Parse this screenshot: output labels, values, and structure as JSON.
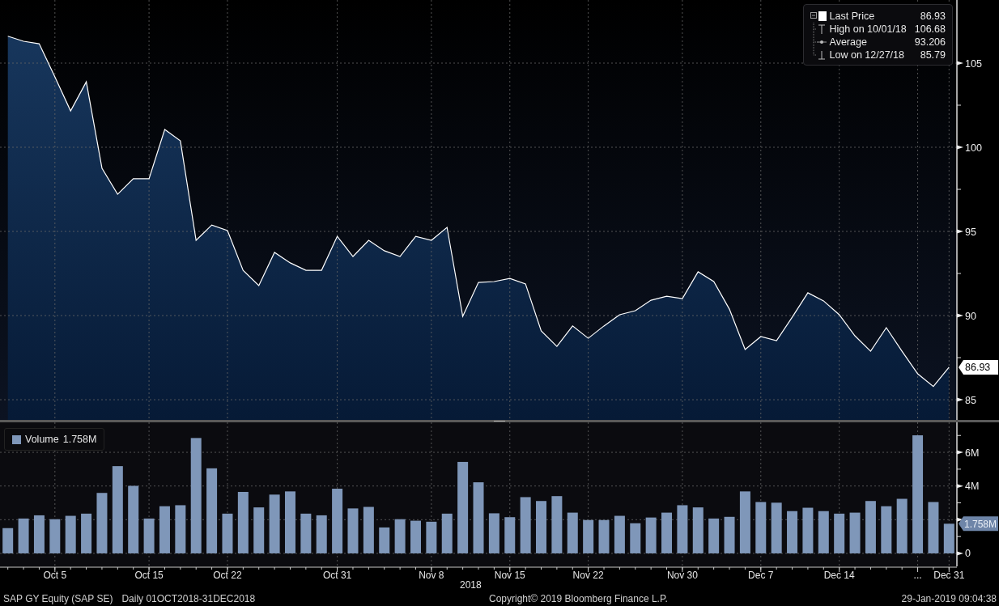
{
  "price_chart": {
    "legend": [
      {
        "kind": "last",
        "value": "86.93"
      },
      {
        "kind": "high",
        "label": "High on 10/01/18",
        "value": "106.68"
      },
      {
        "kind": "average",
        "label": "Average",
        "value": "93.206"
      },
      {
        "kind": "low",
        "label": "Low on 12/27/18",
        "value": "85.79"
      }
    ],
    "last_price_tag": "86.93",
    "chart_data": {
      "type": "area",
      "grid": true,
      "series": [
        {
          "name": "Last Price",
          "color": "#ffffff",
          "values": [
            106.6,
            106.3,
            106.15,
            104.18,
            102.16,
            103.89,
            98.75,
            97.21,
            98.13,
            98.13,
            101.06,
            100.38,
            94.47,
            95.38,
            95.05,
            92.69,
            91.78,
            93.75,
            93.13,
            92.69,
            92.69,
            94.71,
            93.51,
            94.47,
            93.85,
            93.51,
            94.71,
            94.47,
            95.24,
            89.95,
            91.97,
            92.02,
            92.21,
            91.88,
            89.09,
            88.17,
            89.38,
            88.65,
            89.38,
            90.05,
            90.29,
            90.91,
            91.15,
            91.01,
            92.6,
            92.02,
            90.38,
            87.98,
            88.75,
            88.51,
            89.9,
            91.35,
            90.87,
            90.05,
            88.8,
            87.88,
            89.28,
            87.88,
            86.54,
            85.79,
            86.93
          ]
        }
      ],
      "ylim": [
        83.8,
        108.75
      ],
      "yticks": [
        85,
        90,
        95,
        100,
        105
      ]
    }
  },
  "volume_chart": {
    "legend": {
      "value": "1.758M"
    },
    "last_volume_tag": "1.758M",
    "chart_data": {
      "type": "bar",
      "grid": true,
      "xlabel": "2018",
      "categories": [
        null,
        null,
        null,
        "Oct 5",
        null,
        null,
        null,
        null,
        null,
        "Oct 15",
        null,
        null,
        null,
        null,
        "Oct 22",
        null,
        null,
        null,
        null,
        null,
        null,
        "Oct 31",
        null,
        null,
        null,
        null,
        null,
        "Nov 8",
        null,
        null,
        null,
        null,
        "Nov 15",
        null,
        null,
        null,
        null,
        "Nov 22",
        null,
        null,
        null,
        null,
        null,
        "Nov 30",
        null,
        null,
        null,
        null,
        "Dec 7",
        null,
        null,
        null,
        null,
        "Dec 14",
        null,
        null,
        null,
        null,
        "...",
        null,
        "Dec 31"
      ],
      "series": [
        {
          "name": "Volume",
          "color": "#7f97b9",
          "values": [
            1.5,
            2.07,
            2.26,
            2.03,
            2.23,
            2.36,
            3.59,
            5.18,
            4.01,
            2.07,
            2.8,
            2.86,
            6.85,
            5.05,
            2.36,
            3.65,
            2.73,
            3.49,
            3.68,
            2.36,
            2.26,
            3.84,
            2.67,
            2.76,
            1.54,
            2.03,
            1.94,
            1.88,
            2.36,
            5.43,
            4.22,
            2.38,
            2.15,
            3.34,
            3.11,
            3.4,
            2.42,
            1.98,
            1.98,
            2.23,
            1.79,
            2.13,
            2.42,
            2.86,
            2.73,
            2.07,
            2.17,
            3.68,
            3.05,
            3.01,
            2.51,
            2.71,
            2.51,
            2.36,
            2.42,
            3.11,
            2.8,
            3.24,
            7.01,
            3.05,
            1.76
          ]
        }
      ],
      "ylim": [
        -0.77,
        7.78
      ],
      "yticks": [
        {
          "value": 0,
          "label": "0"
        },
        {
          "value": 4,
          "label": "4M"
        },
        {
          "value": 6,
          "label": "6M"
        }
      ]
    }
  },
  "footer": {
    "security": "SAP GY Equity (SAP SE)",
    "period": "Daily 01OCT2018-31DEC2018",
    "copyright": "Copyright© 2019 Bloomberg Finance L.P.",
    "timestamp": "29-Jan-2019 09:04:38"
  }
}
